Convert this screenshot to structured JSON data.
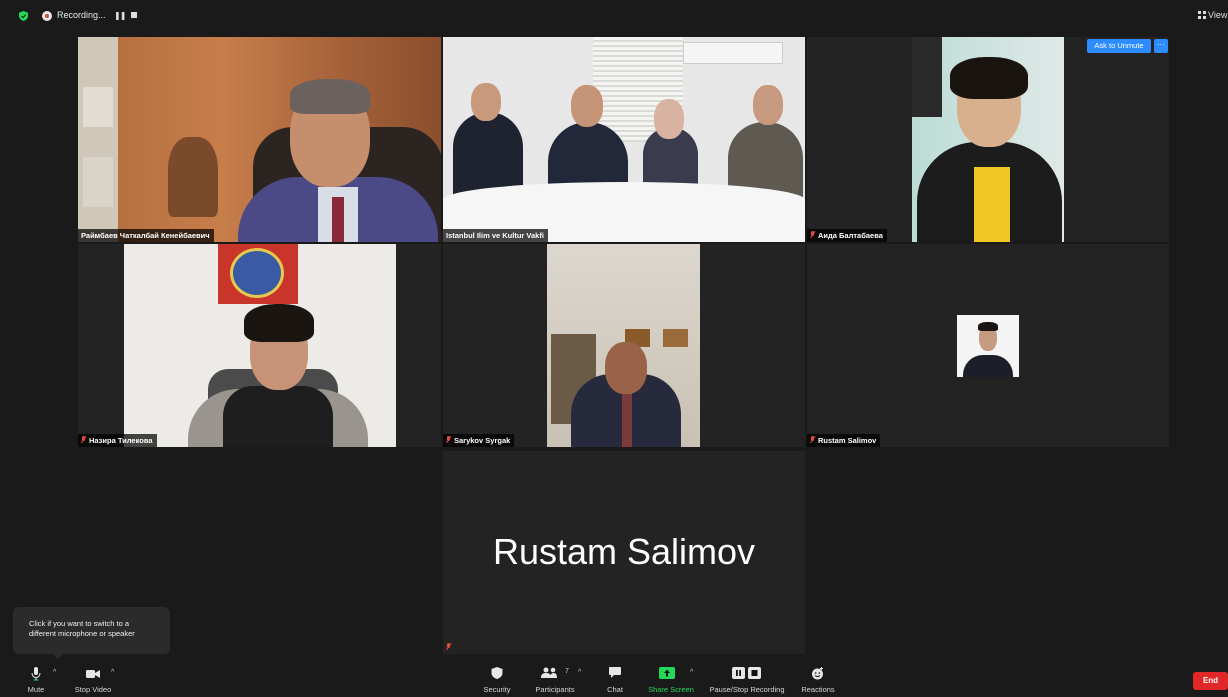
{
  "topbar": {
    "recording_label": "Recording...",
    "view_label": "View"
  },
  "participants": [
    {
      "name": "Раймбаев Чаткалбай Кенейбаевич",
      "muted": false,
      "active": true
    },
    {
      "name": "Istanbul Ilim ve Kultur Vakfi",
      "muted": false,
      "active": false
    },
    {
      "name": "Аида Балтабаева",
      "muted": true,
      "active": false
    },
    {
      "name": "Назира Тилекова",
      "muted": true,
      "active": false
    },
    {
      "name": "Sarykov Syrgak",
      "muted": true,
      "active": false
    },
    {
      "name": "Rustam Salimov",
      "muted": true,
      "active": false
    },
    {
      "name": "",
      "muted": true,
      "active": false,
      "display_name": "Rustam Salimov"
    }
  ],
  "tile3_buttons": {
    "ask_to_unmute": "Ask to Unmute",
    "more": "···"
  },
  "tooltip": {
    "line1": "Click if you want to switch to a",
    "line2": "different microphone or speaker"
  },
  "toolbar": {
    "mute": "Mute",
    "stop_video": "Stop Video",
    "security": "Security",
    "participants": "Participants",
    "participants_count": "7",
    "chat": "Chat",
    "share_screen": "Share Screen",
    "pause_stop_recording": "Pause/Stop Recording",
    "reactions": "Reactions",
    "end": "End"
  },
  "colors": {
    "active_speaker": "#b4d43a",
    "share_green": "#23d959",
    "blue_button": "#2d8cff",
    "end_red": "#e02828",
    "muted_red": "#e24b3c"
  }
}
